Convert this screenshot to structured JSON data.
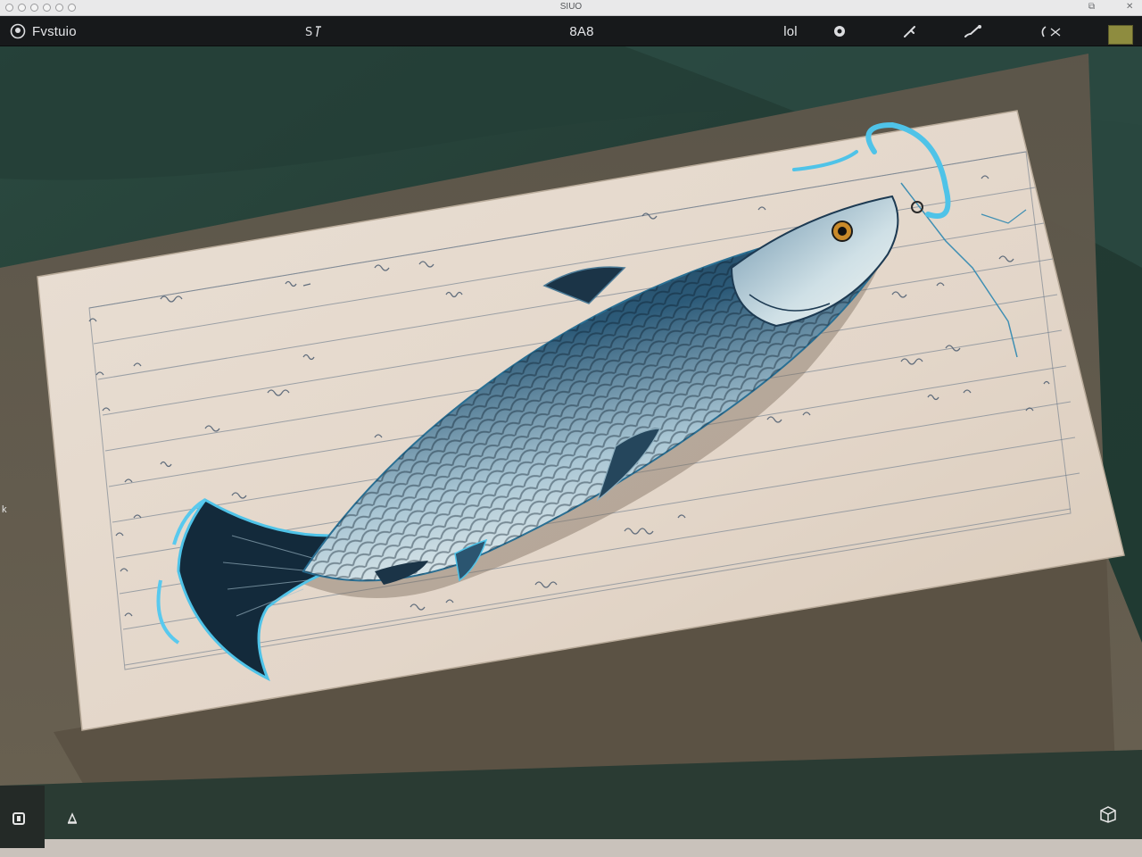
{
  "window": {
    "title": "SIUO"
  },
  "toolbar": {
    "app_name": "Fvstuio",
    "center_label": "8A8",
    "right_label": "lol",
    "icons": [
      "app-logo-icon",
      "text-tool-icon",
      "layers-icon",
      "pen-tool-icon",
      "brush-tool-icon",
      "lasso-tool-icon",
      "color-swatch"
    ]
  },
  "colors": {
    "accent_swatch": "#8e8c3f",
    "toolbar_bg": "#17191b",
    "canvas_teal": "#2b4a3f",
    "paper": "#e6d9cc",
    "fish_dark": "#1d3a52",
    "fish_glow": "#4fc3e8"
  },
  "side": {
    "mark": "k"
  }
}
